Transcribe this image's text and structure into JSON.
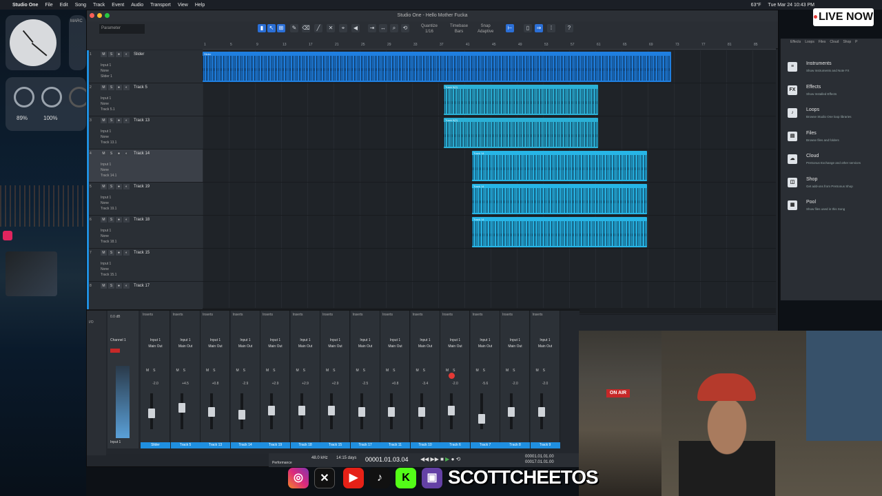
{
  "menubar": {
    "app_name": "Studio One",
    "menus": [
      "File",
      "Edit",
      "Song",
      "Track",
      "Event",
      "Audio",
      "Transport",
      "View",
      "Help"
    ],
    "status": [
      "63°F",
      "Tue Mar 24 10:43 PM"
    ]
  },
  "desktop": {
    "battery_left_pct": "89%",
    "battery_right_pct": "100%",
    "calendar_label": "MARC"
  },
  "window": {
    "title": "Studio One - Hello Mother Fucka"
  },
  "toolbar": {
    "parameter_label": "Parameter",
    "quantize_label": "Quantize",
    "quantize_value": "1/16",
    "timebase_label": "Timebase",
    "timebase_value": "Bars",
    "snap_label": "Snap",
    "snap_value": "Adaptive"
  },
  "ruler_ticks": [
    "1",
    "5",
    "9",
    "13",
    "17",
    "21",
    "25",
    "29",
    "33",
    "37",
    "41",
    "45",
    "49",
    "53",
    "57",
    "61",
    "65",
    "69",
    "73",
    "77",
    "81",
    "85"
  ],
  "tracks": [
    {
      "num": "1",
      "name": "Slider",
      "input": "Input 1",
      "mon": "None",
      "out": "Slider 1"
    },
    {
      "num": "2",
      "name": "Track 5",
      "input": "Input 1",
      "mon": "None",
      "out": "Track 5.1"
    },
    {
      "num": "3",
      "name": "Track 13",
      "input": "Input 1",
      "mon": "None",
      "out": "Track 13.1"
    },
    {
      "num": "4",
      "name": "Track 14",
      "input": "Input 1",
      "mon": "None",
      "out": "Track 14.1"
    },
    {
      "num": "5",
      "name": "Track 19",
      "input": "Input 1",
      "mon": "None",
      "out": "Track 19.1"
    },
    {
      "num": "6",
      "name": "Track 18",
      "input": "Input 1",
      "mon": "None",
      "out": "Track 18.1"
    },
    {
      "num": "7",
      "name": "Track 15",
      "input": "Input 1",
      "mon": "None",
      "out": "Track 15.1"
    },
    {
      "num": "8",
      "name": "Track 17",
      "input": "",
      "mon": "",
      "out": ""
    }
  ],
  "clips": [
    {
      "name": "Slider",
      "lane": 0
    },
    {
      "name": "Track 5(2)",
      "lane": 1
    },
    {
      "name": "Track 5(2)",
      "lane": 2
    },
    {
      "name": "Track 14",
      "lane": 3
    },
    {
      "name": "Track 14",
      "lane": 4
    },
    {
      "name": "Track 14",
      "lane": 5
    }
  ],
  "browser": {
    "tabs": [
      "Effects",
      "Loops",
      "Files",
      "Cloud",
      "Shop",
      "P"
    ],
    "items": [
      {
        "icon": "≡",
        "title": "Instruments",
        "sub": "Show Instruments and Note FX"
      },
      {
        "icon": "FX",
        "title": "Effects",
        "sub": "Show Installed Effects"
      },
      {
        "icon": "♪",
        "title": "Loops",
        "sub": "Browse Studio One loop libraries"
      },
      {
        "icon": "▤",
        "title": "Files",
        "sub": "Browse files and folders"
      },
      {
        "icon": "☁",
        "title": "Cloud",
        "sub": "PreSonus Exchange and other services"
      },
      {
        "icon": "◫",
        "title": "Shop",
        "sub": "Get add-ons from PreSonus Shop"
      },
      {
        "icon": "▦",
        "title": "Pool",
        "sub": "Show files used in this Song"
      }
    ]
  },
  "mixer": {
    "io_label": "I/O",
    "channel1_name": "Channel 1",
    "channel1_db": "0.0 dB",
    "channel1_input": "Input 1",
    "inserts_label": "Inserts",
    "strips": [
      {
        "db": "-2.0",
        "num": "1",
        "name": "Slider",
        "rec": false
      },
      {
        "db": "+4.5",
        "num": "2",
        "name": "Track 5",
        "rec": false
      },
      {
        "db": "+0.8",
        "num": "3",
        "name": "Track 13",
        "rec": false
      },
      {
        "db": "-2.9",
        "num": "4",
        "name": "Track 14",
        "rec": false
      },
      {
        "db": "+2.9",
        "num": "5",
        "name": "Track 19",
        "rec": false
      },
      {
        "db": "+2.9",
        "num": "6",
        "name": "Track 18",
        "rec": false
      },
      {
        "db": "+2.9",
        "num": "7",
        "name": "Track 15",
        "rec": false
      },
      {
        "db": "-2.5",
        "num": "8",
        "name": "Track 17",
        "rec": false
      },
      {
        "db": "+0.8",
        "num": "9",
        "name": "Track 11",
        "rec": false
      },
      {
        "db": "-3.4",
        "num": "10",
        "name": "Track 10",
        "rec": false
      },
      {
        "db": "-2.0",
        "num": "11",
        "name": "Track 6",
        "rec": true
      },
      {
        "db": "-5.6",
        "num": "12",
        "name": "Track 7",
        "rec": false
      },
      {
        "db": "-2.0",
        "num": "13",
        "name": "Track 8",
        "rec": false
      },
      {
        "db": "-2.0",
        "num": "14",
        "name": "Track 9",
        "rec": false
      }
    ],
    "strip_input": "Input 1",
    "strip_output": "Main Out"
  },
  "transport": {
    "sample_rate": "48.0 kHz",
    "record_max": "14:15 days",
    "position": "00001.01.03.04",
    "left_locator": "00001.01.01.00",
    "right_locator": "00017.01.01.00",
    "performance_label": "Performance"
  },
  "overlay": {
    "live_now": "LIVE NOW",
    "on_air": "ON AIR",
    "handle": "SCOTTCHEETOS",
    "social_icons": [
      "instagram-icon",
      "x-icon",
      "youtube-icon",
      "tiktok-icon",
      "kick-icon",
      "twitch-icon"
    ]
  }
}
